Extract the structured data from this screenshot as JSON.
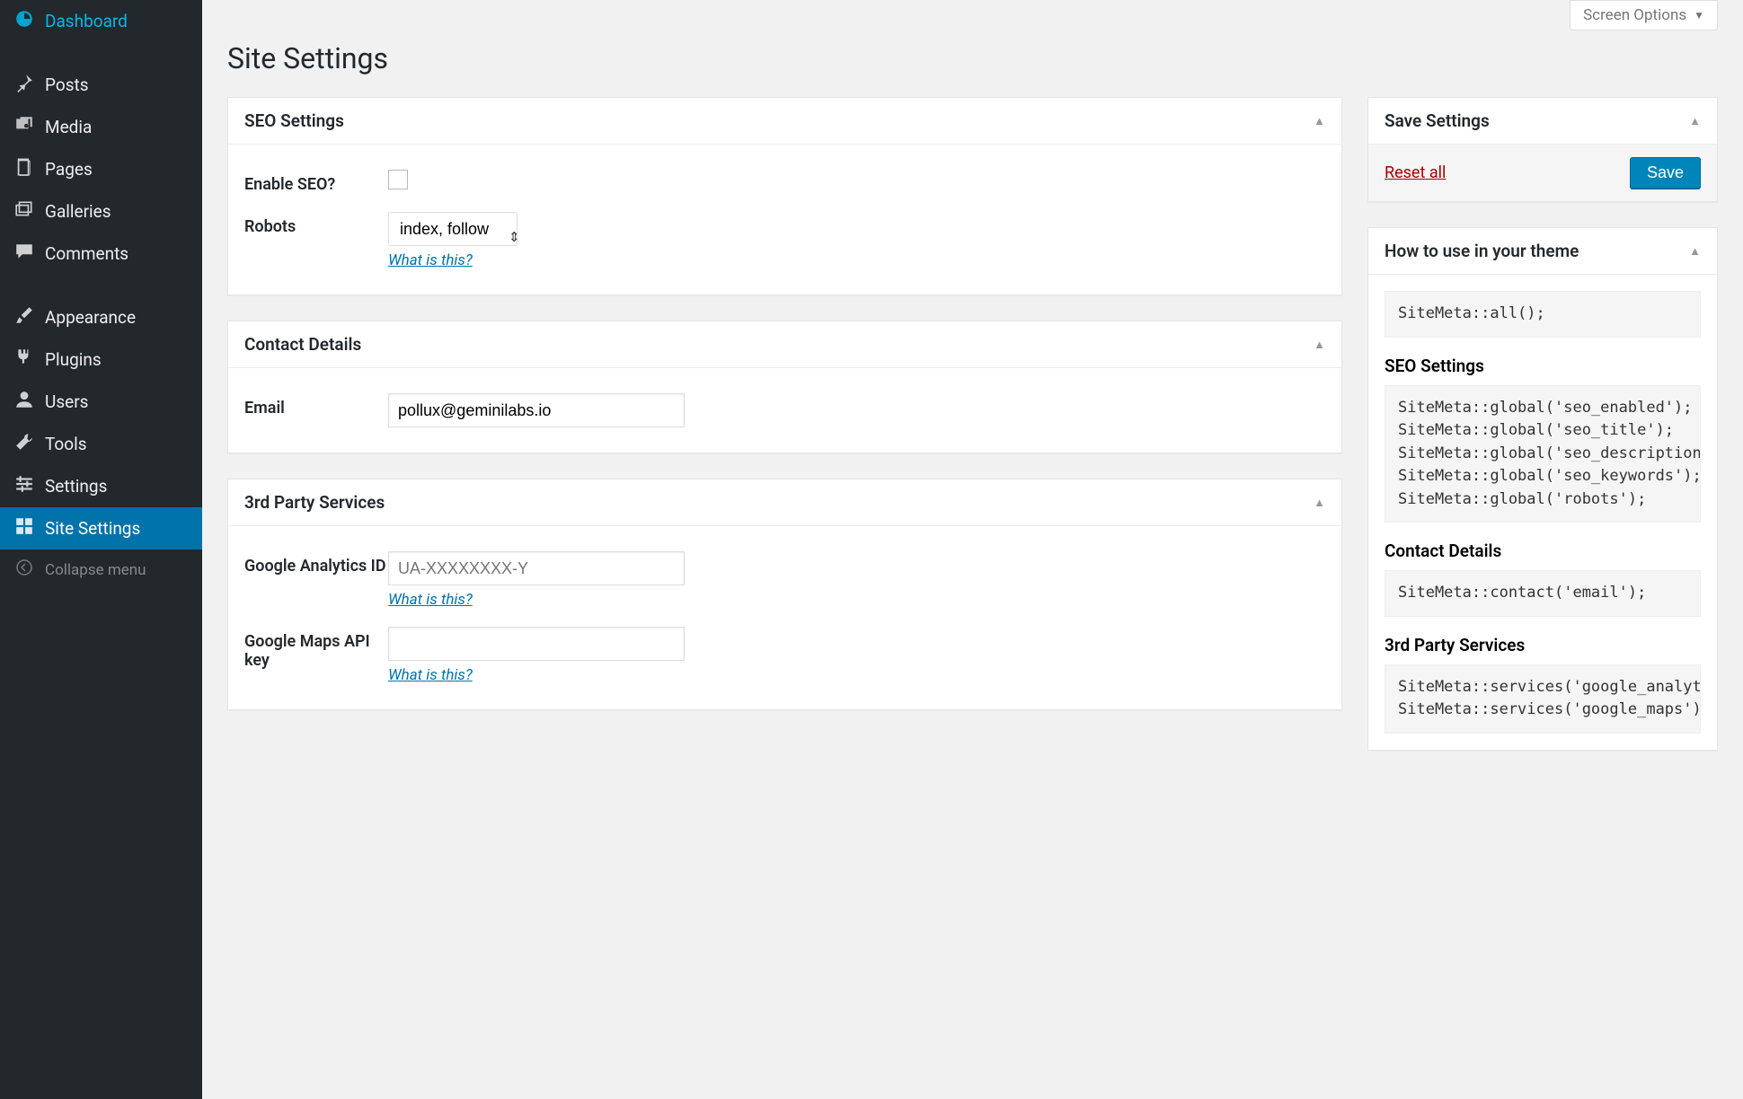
{
  "sidebar": {
    "items": [
      {
        "label": "Dashboard",
        "icon": "dashboard"
      },
      {
        "label": "Posts",
        "icon": "pin"
      },
      {
        "label": "Media",
        "icon": "media"
      },
      {
        "label": "Pages",
        "icon": "page"
      },
      {
        "label": "Galleries",
        "icon": "galleries"
      },
      {
        "label": "Comments",
        "icon": "comment"
      },
      {
        "label": "Appearance",
        "icon": "brush"
      },
      {
        "label": "Plugins",
        "icon": "plug"
      },
      {
        "label": "Users",
        "icon": "user"
      },
      {
        "label": "Tools",
        "icon": "wrench"
      },
      {
        "label": "Settings",
        "icon": "sliders"
      },
      {
        "label": "Site Settings",
        "icon": "grid"
      }
    ],
    "collapse_label": "Collapse menu"
  },
  "top": {
    "screen_options": "Screen Options"
  },
  "page_title": "Site Settings",
  "seo": {
    "title": "SEO Settings",
    "enable_label": "Enable SEO?",
    "robots_label": "Robots",
    "robots_value": "index, follow",
    "help_link": "What is this?"
  },
  "contact": {
    "title": "Contact Details",
    "email_label": "Email",
    "email_value": "pollux@geminilabs.io"
  },
  "services": {
    "title": "3rd Party Services",
    "ga_label": "Google Analytics ID",
    "ga_placeholder": "UA-XXXXXXXX-Y",
    "ga_value": "",
    "ga_help": "What is this?",
    "maps_label": "Google Maps API key",
    "maps_value": "",
    "maps_help": "What is this?"
  },
  "save": {
    "title": "Save Settings",
    "reset": "Reset all",
    "save": "Save"
  },
  "howto": {
    "title": "How to use in your theme",
    "code_all": "SiteMeta::all();",
    "seo_heading": "SEO Settings",
    "code_seo": "SiteMeta::global('seo_enabled');\nSiteMeta::global('seo_title');\nSiteMeta::global('seo_description'\nSiteMeta::global('seo_keywords');\nSiteMeta::global('robots');",
    "contact_heading": "Contact Details",
    "code_contact": "SiteMeta::contact('email');",
    "services_heading": "3rd Party Services",
    "code_services": "SiteMeta::services('google_analyti\nSiteMeta::services('google_maps');"
  }
}
